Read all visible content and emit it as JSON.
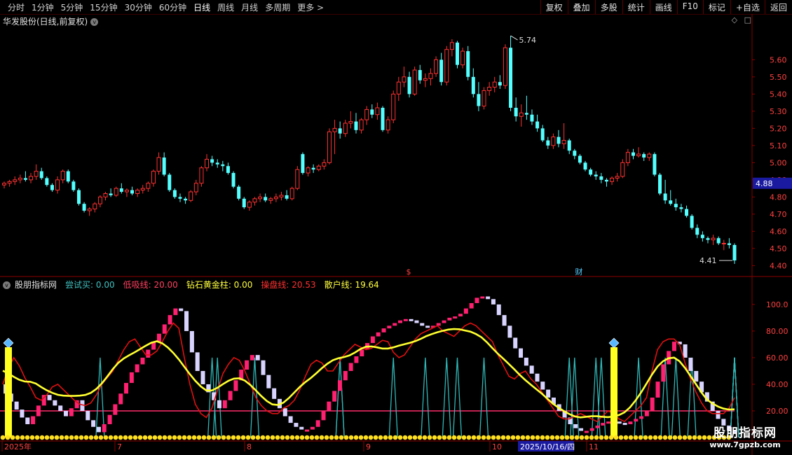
{
  "toolbar": {
    "periods": [
      "分时",
      "1分钟",
      "5分钟",
      "15分钟",
      "30分钟",
      "60分钟",
      "日线",
      "周线",
      "月线",
      "多周期",
      "更多 >"
    ],
    "actions": [
      "复权",
      "叠加",
      "多股",
      "统计",
      "画线",
      "F10",
      "标记",
      "+自选",
      "返回"
    ]
  },
  "chart_title": "华发股份(日线,前复权)",
  "top_icons": [
    "◇",
    "□"
  ],
  "price_axis": {
    "ticks": [
      5.6,
      5.5,
      5.4,
      5.3,
      5.2,
      5.1,
      5.0,
      4.9,
      4.8,
      4.7,
      4.6,
      4.5,
      4.4
    ],
    "ylim": [
      4.365,
      5.785
    ],
    "labels": [
      "5.60",
      "5.50",
      "5.40",
      "5.30",
      "5.20",
      "5.10",
      "5.00",
      "4.90",
      "4.80",
      "4.70",
      "4.60",
      "4.50",
      "4.40"
    ],
    "current": "4.88",
    "high_label": "5.74",
    "low_label": "4.41"
  },
  "markers": {
    "dollar": "$",
    "cai": "财"
  },
  "indicator": {
    "name": "股朋指标网",
    "items": [
      {
        "label": "尝试买: 0.00",
        "color": "#40c0c0"
      },
      {
        "label": "低吸线: 20.00",
        "color": "#ff4060"
      },
      {
        "label": "钻石黄金柱: 0.00",
        "color": "#ffff40"
      },
      {
        "label": "操盘线: 20.53",
        "color": "#ff3030"
      },
      {
        "label": "散户线: 19.64",
        "color": "#ffff40"
      }
    ],
    "axis_ticks": [
      100,
      80,
      60,
      40,
      20
    ],
    "axis_labels": [
      "100.0",
      "80.00",
      "60.00",
      "40.00",
      "20.00"
    ],
    "ylim": [
      0,
      111
    ]
  },
  "date_axis": {
    "labels": [
      "2025年",
      "7",
      "8",
      "9",
      "10",
      "11"
    ],
    "cursor_date": "2025/10/16/四"
  },
  "watermark": {
    "title": "股朋指标网",
    "url": "www.7gpzb.com"
  },
  "colors": {
    "up": "#ff3232",
    "down": "#54ffff",
    "axis": "#8b0000",
    "grid": "#5a0000"
  },
  "chart_data": {
    "type": "candlestick",
    "candles": [
      [
        4.87,
        4.89,
        4.85,
        4.88
      ],
      [
        4.88,
        4.9,
        4.86,
        4.89
      ],
      [
        4.89,
        4.92,
        4.87,
        4.9
      ],
      [
        4.9,
        4.93,
        4.88,
        4.91
      ],
      [
        4.91,
        4.95,
        4.89,
        4.9
      ],
      [
        4.9,
        4.94,
        4.88,
        4.92
      ],
      [
        4.92,
        4.99,
        4.9,
        4.95
      ],
      [
        4.95,
        4.97,
        4.9,
        4.91
      ],
      [
        4.91,
        4.92,
        4.86,
        4.87
      ],
      [
        4.87,
        4.88,
        4.83,
        4.84
      ],
      [
        4.84,
        4.92,
        4.82,
        4.9
      ],
      [
        4.9,
        4.96,
        4.88,
        4.95
      ],
      [
        4.95,
        4.96,
        4.88,
        4.89
      ],
      [
        4.89,
        4.9,
        4.83,
        4.84
      ],
      [
        4.84,
        4.85,
        4.75,
        4.76
      ],
      [
        4.76,
        4.77,
        4.71,
        4.72
      ],
      [
        4.72,
        4.74,
        4.69,
        4.73
      ],
      [
        4.73,
        4.77,
        4.71,
        4.76
      ],
      [
        4.76,
        4.81,
        4.74,
        4.8
      ],
      [
        4.8,
        4.83,
        4.78,
        4.82
      ],
      [
        4.82,
        4.85,
        4.8,
        4.81
      ],
      [
        4.81,
        4.86,
        4.8,
        4.85
      ],
      [
        4.85,
        4.88,
        4.82,
        4.83
      ],
      [
        4.83,
        4.85,
        4.8,
        4.84
      ],
      [
        4.84,
        4.86,
        4.81,
        4.82
      ],
      [
        4.82,
        4.85,
        4.8,
        4.84
      ],
      [
        4.84,
        4.87,
        4.82,
        4.85
      ],
      [
        4.85,
        4.89,
        4.83,
        4.88
      ],
      [
        4.88,
        4.96,
        4.86,
        4.95
      ],
      [
        4.95,
        5.06,
        4.93,
        5.03
      ],
      [
        5.03,
        5.06,
        4.92,
        4.93
      ],
      [
        4.93,
        4.94,
        4.83,
        4.84
      ],
      [
        4.84,
        4.85,
        4.79,
        4.8
      ],
      [
        4.8,
        4.82,
        4.77,
        4.79
      ],
      [
        4.79,
        4.8,
        4.76,
        4.78
      ],
      [
        4.78,
        4.84,
        4.77,
        4.83
      ],
      [
        4.83,
        4.9,
        4.81,
        4.88
      ],
      [
        4.88,
        4.98,
        4.86,
        4.97
      ],
      [
        4.97,
        5.05,
        4.95,
        5.02
      ],
      [
        5.02,
        5.04,
        4.98,
        5.0
      ],
      [
        5.0,
        5.02,
        4.97,
        4.99
      ],
      [
        4.99,
        5.01,
        4.95,
        4.98
      ],
      [
        4.98,
        5.0,
        4.93,
        4.94
      ],
      [
        4.94,
        4.95,
        4.85,
        4.86
      ],
      [
        4.86,
        4.87,
        4.78,
        4.79
      ],
      [
        4.79,
        4.8,
        4.73,
        4.74
      ],
      [
        4.74,
        4.78,
        4.72,
        4.77
      ],
      [
        4.77,
        4.8,
        4.75,
        4.79
      ],
      [
        4.79,
        4.82,
        4.77,
        4.8
      ],
      [
        4.8,
        4.82,
        4.77,
        4.78
      ],
      [
        4.78,
        4.8,
        4.76,
        4.79
      ],
      [
        4.79,
        4.82,
        4.77,
        4.8
      ],
      [
        4.8,
        4.83,
        4.78,
        4.81
      ],
      [
        4.81,
        4.84,
        4.78,
        4.79
      ],
      [
        4.79,
        4.86,
        4.78,
        4.85
      ],
      [
        4.85,
        4.98,
        4.84,
        4.96
      ],
      [
        5.05,
        5.06,
        4.93,
        4.94
      ],
      [
        4.94,
        4.98,
        4.92,
        4.97
      ],
      [
        4.97,
        4.99,
        4.94,
        4.96
      ],
      [
        4.96,
        4.99,
        4.95,
        4.98
      ],
      [
        4.98,
        5.02,
        4.96,
        5.0
      ],
      [
        5.0,
        5.2,
        4.99,
        5.18
      ],
      [
        5.18,
        5.25,
        5.05,
        5.2
      ],
      [
        5.2,
        5.24,
        5.14,
        5.17
      ],
      [
        5.17,
        5.25,
        5.15,
        5.23
      ],
      [
        5.23,
        5.3,
        5.2,
        5.24
      ],
      [
        5.24,
        5.29,
        5.17,
        5.19
      ],
      [
        5.19,
        5.26,
        5.17,
        5.25
      ],
      [
        5.25,
        5.33,
        5.22,
        5.31
      ],
      [
        5.31,
        5.34,
        5.26,
        5.28
      ],
      [
        5.28,
        5.35,
        5.25,
        5.32
      ],
      [
        5.32,
        5.33,
        5.18,
        5.19
      ],
      [
        5.19,
        5.27,
        5.17,
        5.25
      ],
      [
        5.25,
        5.42,
        5.23,
        5.4
      ],
      [
        5.4,
        5.5,
        5.36,
        5.47
      ],
      [
        5.47,
        5.56,
        5.44,
        5.5
      ],
      [
        5.5,
        5.53,
        5.38,
        5.4
      ],
      [
        5.4,
        5.56,
        5.39,
        5.54
      ],
      [
        5.54,
        5.57,
        5.46,
        5.48
      ],
      [
        5.48,
        5.52,
        5.44,
        5.49
      ],
      [
        5.49,
        5.55,
        5.45,
        5.52
      ],
      [
        5.52,
        5.62,
        5.5,
        5.6
      ],
      [
        5.6,
        5.64,
        5.45,
        5.47
      ],
      [
        5.47,
        5.68,
        5.45,
        5.66
      ],
      [
        5.66,
        5.72,
        5.62,
        5.7
      ],
      [
        5.7,
        5.71,
        5.55,
        5.57
      ],
      [
        5.57,
        5.67,
        5.55,
        5.65
      ],
      [
        5.65,
        5.68,
        5.48,
        5.5
      ],
      [
        5.5,
        5.55,
        5.38,
        5.4
      ],
      [
        5.4,
        5.47,
        5.3,
        5.33
      ],
      [
        5.33,
        5.44,
        5.31,
        5.42
      ],
      [
        5.42,
        5.47,
        5.39,
        5.44
      ],
      [
        5.44,
        5.5,
        5.41,
        5.47
      ],
      [
        5.47,
        5.51,
        5.43,
        5.45
      ],
      [
        5.45,
        5.69,
        5.43,
        5.67
      ],
      [
        5.67,
        5.74,
        5.3,
        5.32
      ],
      [
        5.32,
        5.38,
        5.24,
        5.27
      ],
      [
        5.27,
        5.34,
        5.21,
        5.29
      ],
      [
        5.29,
        5.39,
        5.25,
        5.28
      ],
      [
        5.28,
        5.31,
        5.22,
        5.24
      ],
      [
        5.24,
        5.28,
        5.18,
        5.2
      ],
      [
        5.2,
        5.22,
        5.12,
        5.13
      ],
      [
        5.13,
        5.15,
        5.08,
        5.1
      ],
      [
        5.1,
        5.17,
        5.08,
        5.15
      ],
      [
        5.15,
        5.19,
        5.09,
        5.11
      ],
      [
        5.11,
        5.23,
        5.08,
        5.13
      ],
      [
        5.13,
        5.14,
        5.05,
        5.07
      ],
      [
        5.07,
        5.08,
        5.02,
        5.04
      ],
      [
        5.04,
        5.05,
        4.99,
        5.0
      ],
      [
        5.0,
        5.01,
        4.95,
        4.96
      ],
      [
        4.96,
        4.97,
        4.92,
        4.93
      ],
      [
        4.93,
        4.95,
        4.9,
        4.92
      ],
      [
        4.92,
        4.94,
        4.88,
        4.9
      ],
      [
        4.9,
        4.91,
        4.86,
        4.89
      ],
      [
        4.89,
        4.92,
        4.87,
        4.91
      ],
      [
        4.91,
        4.94,
        4.89,
        4.92
      ],
      [
        4.92,
        5.02,
        4.91,
        5.0
      ],
      [
        5.0,
        5.08,
        4.98,
        5.06
      ],
      [
        5.06,
        5.08,
        5.02,
        5.04
      ],
      [
        5.04,
        5.09,
        5.03,
        5.05
      ],
      [
        5.05,
        5.06,
        5.01,
        5.03
      ],
      [
        5.03,
        5.06,
        5.01,
        5.05
      ],
      [
        5.05,
        5.06,
        4.92,
        4.93
      ],
      [
        4.93,
        4.94,
        4.81,
        4.82
      ],
      [
        4.82,
        4.9,
        4.76,
        4.78
      ],
      [
        4.78,
        4.84,
        4.75,
        4.76
      ],
      [
        4.76,
        4.79,
        4.72,
        4.74
      ],
      [
        4.74,
        4.76,
        4.71,
        4.73
      ],
      [
        4.73,
        4.75,
        4.68,
        4.69
      ],
      [
        4.69,
        4.7,
        4.61,
        4.62
      ],
      [
        4.62,
        4.64,
        4.56,
        4.58
      ],
      [
        4.58,
        4.6,
        4.54,
        4.56
      ],
      [
        4.56,
        4.57,
        4.53,
        4.55
      ],
      [
        4.55,
        4.58,
        4.52,
        4.56
      ],
      [
        4.56,
        4.57,
        4.52,
        4.53
      ],
      [
        4.53,
        4.55,
        4.49,
        4.53
      ],
      [
        4.53,
        4.56,
        4.5,
        4.52
      ],
      [
        4.52,
        4.53,
        4.41,
        4.43
      ]
    ],
    "ind_candles": [
      [
        40,
        33
      ],
      [
        33,
        27
      ],
      [
        27,
        21
      ],
      [
        21,
        15
      ],
      [
        15,
        10
      ],
      [
        10,
        16
      ],
      [
        16,
        24
      ],
      [
        24,
        32
      ],
      [
        32,
        28
      ],
      [
        28,
        24
      ],
      [
        24,
        20
      ],
      [
        20,
        16
      ],
      [
        16,
        22
      ],
      [
        22,
        28
      ],
      [
        28,
        20
      ],
      [
        20,
        13
      ],
      [
        13,
        8
      ],
      [
        8,
        4
      ],
      [
        4,
        10
      ],
      [
        10,
        17
      ],
      [
        17,
        25
      ],
      [
        25,
        33
      ],
      [
        33,
        41
      ],
      [
        41,
        49
      ],
      [
        49,
        55
      ],
      [
        55,
        60
      ],
      [
        60,
        66
      ],
      [
        66,
        72
      ],
      [
        72,
        78
      ],
      [
        78,
        85
      ],
      [
        85,
        92
      ],
      [
        92,
        97
      ],
      [
        97,
        95
      ],
      [
        95,
        80
      ],
      [
        80,
        64
      ],
      [
        64,
        50
      ],
      [
        50,
        40
      ],
      [
        40,
        34
      ],
      [
        34,
        28
      ],
      [
        28,
        22
      ],
      [
        22,
        28
      ],
      [
        28,
        35
      ],
      [
        35,
        43
      ],
      [
        43,
        51
      ],
      [
        51,
        58
      ],
      [
        58,
        62
      ],
      [
        62,
        58
      ],
      [
        58,
        47
      ],
      [
        47,
        37
      ],
      [
        37,
        29
      ],
      [
        29,
        22
      ],
      [
        22,
        16
      ],
      [
        16,
        11
      ],
      [
        11,
        8
      ],
      [
        8,
        6
      ],
      [
        6,
        6
      ],
      [
        6,
        8
      ],
      [
        8,
        13
      ],
      [
        13,
        20
      ],
      [
        20,
        27
      ],
      [
        27,
        35
      ],
      [
        35,
        43
      ],
      [
        43,
        50
      ],
      [
        50,
        56
      ],
      [
        56,
        61
      ],
      [
        61,
        66
      ],
      [
        66,
        71
      ],
      [
        71,
        76
      ],
      [
        76,
        79
      ],
      [
        79,
        82
      ],
      [
        82,
        84
      ],
      [
        84,
        86
      ],
      [
        86,
        88
      ],
      [
        88,
        89
      ],
      [
        89,
        88
      ],
      [
        88,
        86
      ],
      [
        86,
        84
      ],
      [
        84,
        83
      ],
      [
        83,
        84
      ],
      [
        84,
        86
      ],
      [
        86,
        88
      ],
      [
        88,
        90
      ],
      [
        90,
        91
      ],
      [
        91,
        93
      ],
      [
        93,
        97
      ],
      [
        97,
        101
      ],
      [
        101,
        105
      ],
      [
        105,
        106
      ],
      [
        106,
        104
      ],
      [
        104,
        100
      ],
      [
        100,
        92
      ],
      [
        92,
        84
      ],
      [
        84,
        75
      ],
      [
        75,
        67
      ],
      [
        67,
        60
      ],
      [
        60,
        54
      ],
      [
        54,
        48
      ],
      [
        48,
        42
      ],
      [
        42,
        36
      ],
      [
        36,
        30
      ],
      [
        30,
        25
      ],
      [
        25,
        20
      ],
      [
        20,
        15
      ],
      [
        15,
        10
      ],
      [
        10,
        7
      ],
      [
        7,
        5
      ],
      [
        5,
        5
      ],
      [
        5,
        7
      ],
      [
        7,
        9
      ],
      [
        9,
        11
      ],
      [
        11,
        12
      ],
      [
        12,
        12
      ],
      [
        12,
        11
      ],
      [
        11,
        10
      ],
      [
        10,
        12
      ],
      [
        12,
        14
      ],
      [
        14,
        16
      ],
      [
        16,
        20
      ],
      [
        20,
        30
      ],
      [
        30,
        42
      ],
      [
        42,
        55
      ],
      [
        55,
        65
      ],
      [
        65,
        72
      ],
      [
        72,
        70
      ],
      [
        70,
        60
      ],
      [
        60,
        50
      ],
      [
        50,
        42
      ],
      [
        42,
        34
      ],
      [
        34,
        27
      ],
      [
        27,
        20
      ],
      [
        20,
        14
      ],
      [
        14,
        9
      ],
      [
        9,
        5
      ],
      [
        5,
        3
      ]
    ],
    "trader_line": [
      40,
      52,
      60,
      54,
      45,
      38,
      30,
      28,
      32,
      38,
      40,
      36,
      32,
      28,
      25,
      24,
      26,
      32,
      40,
      45,
      50,
      58,
      66,
      72,
      74,
      68,
      62,
      62,
      65,
      72,
      80,
      86,
      82,
      60,
      40,
      25,
      18,
      15,
      22,
      35,
      48,
      55,
      60,
      58,
      50,
      40,
      30,
      24,
      20,
      18,
      18,
      22,
      24,
      28,
      36,
      46,
      55,
      58,
      56,
      50,
      50,
      56,
      62,
      66,
      70,
      68,
      66,
      67,
      70,
      73,
      72,
      64,
      60,
      62,
      68,
      74,
      78,
      80,
      82,
      84,
      80,
      78,
      76,
      80,
      84,
      86,
      84,
      80,
      76,
      72,
      62,
      54,
      46,
      44,
      48,
      50,
      44,
      40,
      34,
      28,
      22,
      16,
      14,
      14,
      16,
      18,
      16,
      14,
      12,
      16,
      20,
      18,
      14,
      12,
      16,
      20,
      24,
      30,
      50,
      66,
      72,
      74,
      74,
      70,
      56,
      44,
      34,
      26,
      20,
      18,
      18,
      18,
      22,
      30
    ]
  }
}
